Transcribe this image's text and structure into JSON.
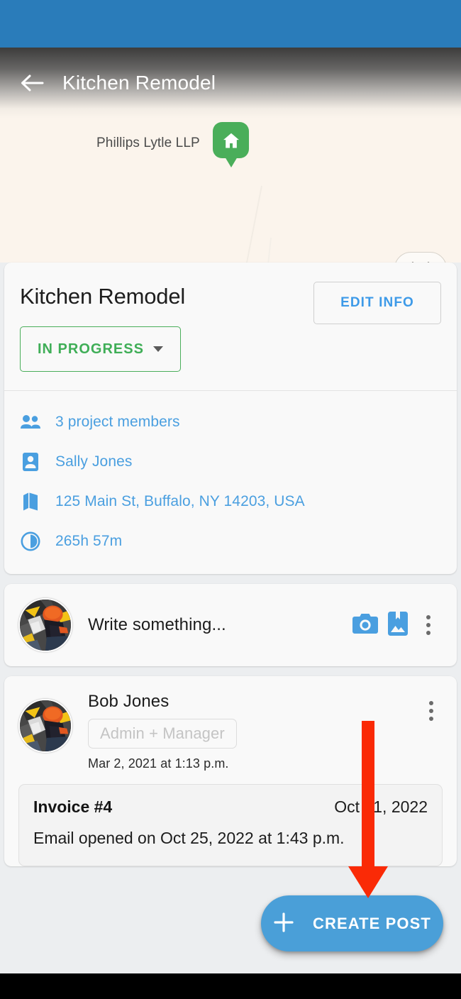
{
  "status_bar": {
    "color": "#2a7cba"
  },
  "toolbar": {
    "back_icon": "arrow-left-icon",
    "title": "Kitchen Remodel"
  },
  "map": {
    "place_label": "Phillips Lytle LLP",
    "pin_icon": "home-pin-icon",
    "pin_color": "#4aae5a",
    "expand_icon": "chevron-down-icon",
    "background_color": "#fbf4ec"
  },
  "project": {
    "title": "Kitchen Remodel",
    "edit_button": "EDIT INFO",
    "status": "IN PROGRESS",
    "status_color": "#3fae57",
    "info_rows": [
      {
        "icon": "people-icon",
        "label": "3 project members"
      },
      {
        "icon": "person-card-icon",
        "label": "Sally Jones"
      },
      {
        "icon": "map-icon",
        "label": "125 Main St, Buffalo, NY 14203, USA"
      },
      {
        "icon": "clock-icon",
        "label": "265h 57m"
      }
    ]
  },
  "composer": {
    "avatar": "user-avatar-motorcyclist",
    "placeholder": "Write something...",
    "camera_icon": "camera-icon",
    "gallery_icon": "photo-album-icon",
    "more_icon": "kebab-menu-icon"
  },
  "post": {
    "avatar": "user-avatar-motorcyclist",
    "author": "Bob Jones",
    "role": "Admin + Manager",
    "date": "Mar 2, 2021 at 1:13 p.m.",
    "more_icon": "kebab-menu-icon",
    "invoice": {
      "title": "Invoice #4",
      "date": "Oct 21, 2022",
      "body": "Email opened on Oct 25, 2022 at 1:43 p.m."
    }
  },
  "fab": {
    "icon": "plus-icon",
    "label": "CREATE POST",
    "color": "#4a9fd8"
  },
  "annotation": {
    "arrow_icon": "down-arrow-annotation",
    "color": "#fa2a06"
  }
}
